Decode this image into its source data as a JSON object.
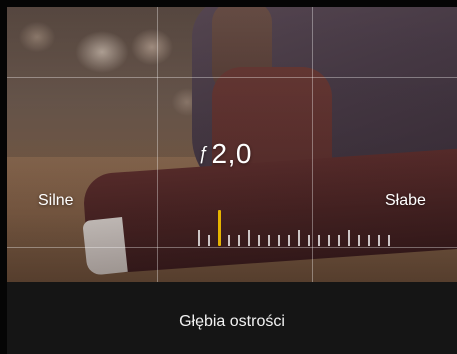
{
  "viewfinder": {
    "aperture_symbol": "ƒ",
    "aperture_value": "2,0",
    "label_strong": "Silne",
    "label_weak": "Słabe",
    "depth_slider": {
      "tick_count": 20,
      "selected_index": 2,
      "accent_color": "#e6b400"
    }
  },
  "bottom_bar": {
    "title": "Głębia ostrości"
  }
}
